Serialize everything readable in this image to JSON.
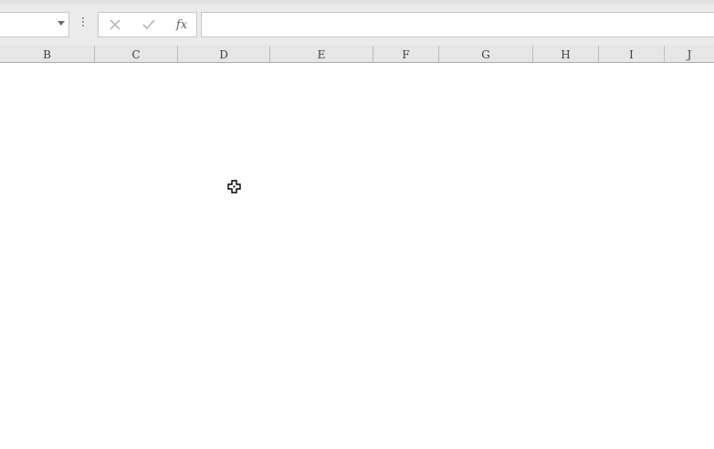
{
  "name_box": {
    "value": "",
    "dropdown_icon": "caret-down-icon"
  },
  "formula_bar": {
    "cancel_icon": "cancel-x-icon",
    "enter_icon": "checkmark-icon",
    "insert_function_label": "fx",
    "formula_value": ""
  },
  "columns": [
    "B",
    "C",
    "D",
    "E",
    "F",
    "G",
    "H",
    "I",
    "J"
  ],
  "cursor_icon": "cell-select-cross-cursor-icon",
  "colors": {
    "toolbar_bg": "#ebebeb",
    "header_bg": "#e6e6e6",
    "grid_bg": "#ffffff",
    "border": "#c6c6c6"
  }
}
